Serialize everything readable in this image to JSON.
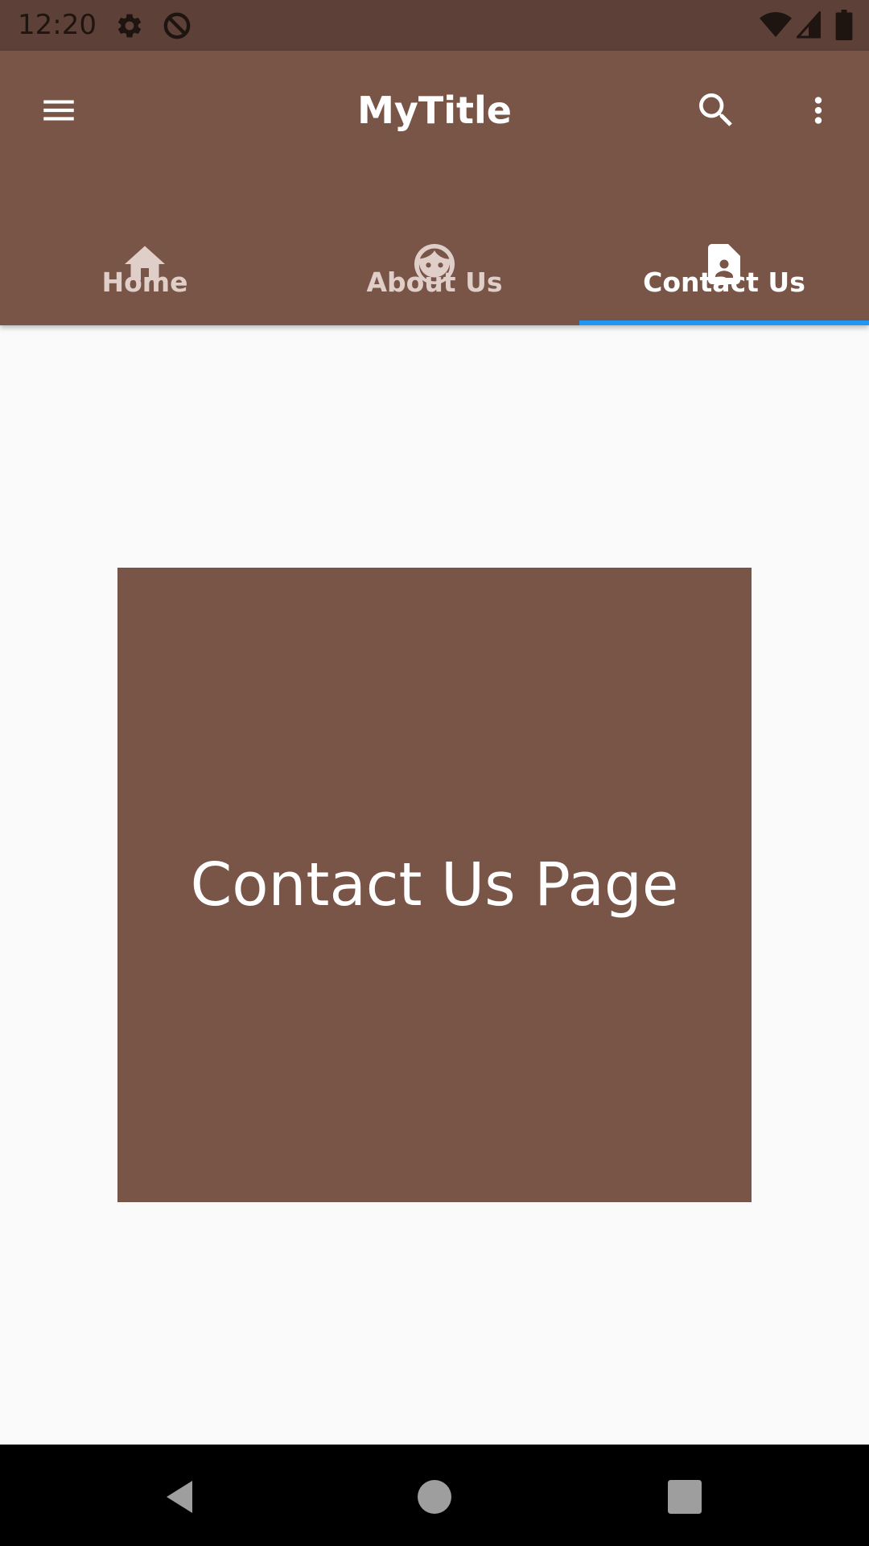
{
  "status_bar": {
    "time": "12:20",
    "left_icons": [
      "gear-icon",
      "do-not-disturb-icon"
    ],
    "right_icons": [
      "wifi-icon",
      "cell-signal-icon",
      "battery-icon"
    ]
  },
  "app_bar": {
    "title": "MyTitle",
    "menu_icon": "menu-icon",
    "search_icon": "search-icon",
    "overflow_icon": "more-vert-icon"
  },
  "tabs": [
    {
      "label": "Home",
      "icon": "home-icon",
      "selected": false
    },
    {
      "label": "About Us",
      "icon": "face-icon",
      "selected": false
    },
    {
      "label": "Contact Us",
      "icon": "contact-page-icon",
      "selected": true
    }
  ],
  "content": {
    "text": "Contact Us Page"
  },
  "nav_bar": {
    "buttons": [
      "back-icon",
      "home-circle-icon",
      "recents-icon"
    ]
  },
  "colors": {
    "status_bar": "#5d4037",
    "primary": "#795548",
    "tab_indicator": "#2196f3",
    "background": "#fafafa",
    "nav_bar": "#000000"
  }
}
